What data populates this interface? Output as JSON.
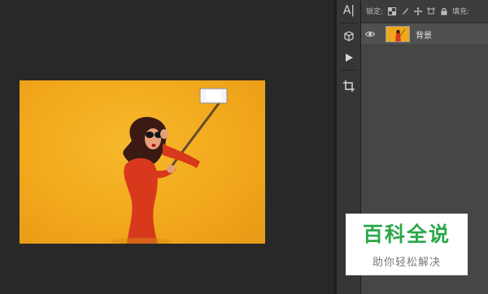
{
  "toolbar": {
    "type_tool_label": "A|",
    "tools": [
      "type-tool",
      "3d-tool",
      "play-tool",
      "crop-tool"
    ]
  },
  "layers": {
    "lock_label": "锁定:",
    "fill_label": "填充:",
    "items": [
      {
        "name": "背景",
        "visible": true
      }
    ]
  },
  "watermark": {
    "title": "百科全说",
    "subtitle": "助你轻松解决"
  },
  "colors": {
    "canvas_bg": "#282828",
    "photo_bg": "#f2a81c",
    "dress": "#d8391c",
    "panel_bg": "#3c3c3c",
    "watermark_green": "#2aa84a"
  }
}
